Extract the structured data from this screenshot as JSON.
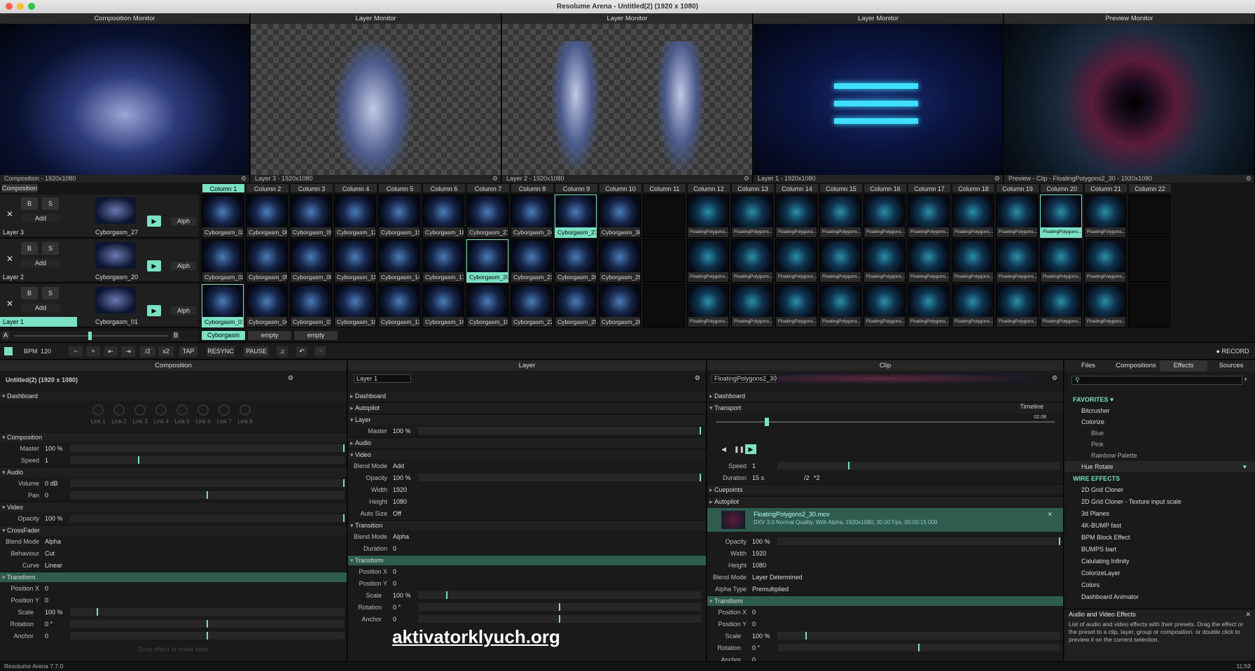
{
  "app": {
    "window_title": "Resolume Arena - Untitled(2) (1920 x 1080)",
    "version": "Resolume Arena 7.7.0",
    "clock": "11:59"
  },
  "monitors": [
    {
      "title": "Composition Monitor",
      "footer": "Composition - 1920x1080"
    },
    {
      "title": "Layer Monitor",
      "footer": "Layer 3 - 1920x1080"
    },
    {
      "title": "Layer Monitor",
      "footer": "Layer 2 - 1920x1080"
    },
    {
      "title": "Layer Monitor",
      "footer": "Layer 1 - 1920x1080"
    },
    {
      "title": "Preview Monitor",
      "footer": "Preview - Clip - FloatingPolygons2_30 - 1920x1080"
    }
  ],
  "deck": {
    "composition_label": "Composition",
    "columns": [
      "Column 1",
      "Column 2",
      "Column 3",
      "Column 4",
      "Column 5",
      "Column 6",
      "Column 7",
      "Column 8",
      "Column 9",
      "Column 10",
      "Column 11",
      "Column 12",
      "Column 13",
      "Column 14",
      "Column 15",
      "Column 16",
      "Column 17",
      "Column 18",
      "Column 19",
      "Column 20",
      "Column 21",
      "Column 22"
    ],
    "layers": [
      {
        "name": "Layer 3",
        "current_clip": "Cyborgasm_27",
        "clips": [
          "Cyborgasm_03",
          "Cyborgasm_06",
          "Cyborgasm_09",
          "Cyborgasm_12",
          "Cyborgasm_15",
          "Cyborgasm_18",
          "Cyborgasm_21",
          "Cyborgasm_24",
          "Cyborgasm_27",
          "Cyborgasm_30",
          "",
          "FloatingPolygons...",
          "FloatingPolygons...",
          "FloatingPolygons...",
          "FloatingPolygons...",
          "FloatingPolygons...",
          "FloatingPolygons...",
          "FloatingPolygons...",
          "FloatingPolygons...",
          "FloatingPolygons...",
          "FloatingPolygons...",
          ""
        ]
      },
      {
        "name": "Layer 2",
        "current_clip": "Cyborgasm_20",
        "clips": [
          "Cyborgasm_02",
          "Cyborgasm_05",
          "Cyborgasm_08",
          "Cyborgasm_11",
          "Cyborgasm_14",
          "Cyborgasm_17",
          "Cyborgasm_20",
          "Cyborgasm_23",
          "Cyborgasm_26",
          "Cyborgasm_29",
          "",
          "FloatingPolygons...",
          "FloatingPolygons...",
          "FloatingPolygons...",
          "FloatingPolygons...",
          "FloatingPolygons...",
          "FloatingPolygons...",
          "FloatingPolygons...",
          "FloatingPolygons...",
          "FloatingPolygons...",
          "FloatingPolygons...",
          ""
        ]
      },
      {
        "name": "Layer 1",
        "current_clip": "Cyborgasm_01",
        "clips": [
          "Cyborgasm_01",
          "Cyborgasm_04",
          "Cyborgasm_07",
          "Cyborgasm_10",
          "Cyborgasm_13",
          "Cyborgasm_16",
          "Cyborgasm_19",
          "Cyborgasm_22",
          "Cyborgasm_25",
          "Cyborgasm_28",
          "",
          "FloatingPolygons...",
          "FloatingPolygons...",
          "FloatingPolygons...",
          "FloatingPolygons...",
          "FloatingPolygons...",
          "FloatingPolygons...",
          "FloatingPolygons...",
          "FloatingPolygons...",
          "FloatingPolygons...",
          "FloatingPolygons...",
          ""
        ]
      }
    ],
    "layer_controls": {
      "bypass": "B",
      "solo": "S",
      "add": "Add",
      "alpha": "Alph",
      "a": "A",
      "b": "B"
    },
    "decks": [
      "Cyborgasm",
      "empty",
      "empty"
    ]
  },
  "toolbar": {
    "bpm_label": "BPM",
    "bpm": "120",
    "minus": "−",
    "plus": "+",
    "half": "/2",
    "double": "x2",
    "tap": "TAP",
    "resync": "RESYNC",
    "pause": "PAUSE",
    "record": "● RECORD"
  },
  "composition_panel": {
    "header": "Composition",
    "name": "Untitled(2) (1920 x 1080)",
    "dashboard": "Dashboard",
    "links": [
      "Link 1",
      "Link 2",
      "Link 3",
      "Link 4",
      "Link 5",
      "Link 6",
      "Link 7",
      "Link 8"
    ],
    "composition": "Composition",
    "master_label": "Master",
    "master": "100 %",
    "speed_label": "Speed",
    "speed": "1",
    "audio": "Audio",
    "volume_label": "Volume",
    "volume": "0 dB",
    "pan_label": "Pan",
    "pan": "0",
    "video": "Video",
    "opacity_label": "Opacity",
    "opacity": "100 %",
    "crossfader": "CrossFader",
    "blend_label": "Blend Mode",
    "blend": "Alpha",
    "behaviour_label": "Behaviour",
    "behaviour": "Cut",
    "curve_label": "Curve",
    "curve": "Linear",
    "transform": "Transform",
    "posx_label": "Position X",
    "posx": "0",
    "posy_label": "Position Y",
    "posy": "0",
    "scale_label": "Scale",
    "scale": "100 %",
    "rotation_label": "Rotation",
    "rotation": "0 °",
    "anchor_label": "Anchor",
    "anchor": "0",
    "drop_hint": "Drop effect or mask here"
  },
  "layer_panel": {
    "header": "Layer",
    "name": "Layer 1",
    "dashboard": "Dashboard",
    "autopilot": "Autopilot",
    "layer": "Layer",
    "master_label": "Master",
    "master": "100 %",
    "audio": "Audio",
    "video": "Video",
    "blend_label": "Blend Mode",
    "blend": "Add",
    "opacity_label": "Opacity",
    "opacity": "100 %",
    "width_label": "Width",
    "width": "1920",
    "height_label": "Height",
    "height": "1080",
    "autosize_label": "Auto Size",
    "autosize": "Off",
    "transition": "Transition",
    "tblend_label": "Blend Mode",
    "tblend": "Alpha",
    "duration_label": "Duration",
    "duration": "0",
    "transform": "Transform",
    "posx_label": "Position X",
    "posx": "0",
    "posy_label": "Position Y",
    "posy": "0",
    "scale_label": "Scale",
    "scale": "100 %",
    "rotation_label": "Rotation",
    "rotation": "0 °",
    "anchor_label": "Anchor",
    "anchor": "0"
  },
  "clip_panel": {
    "header": "Clip",
    "name": "FloatingPolygons2_30",
    "dashboard": "Dashboard",
    "transport": "Transport",
    "timeline": "Timeline",
    "time_end": "02.08",
    "speed_label": "Speed",
    "speed": "1",
    "duration_label": "Duration",
    "duration": "15 s",
    "half": "/2",
    "double": "*2",
    "cuepoints": "Cuepoints",
    "autopilot": "Autopilot",
    "file": "FloatingPolygons2_30.mov",
    "file_info": "DXV 3.0 Normal Quality, With Alpha, 1920x1080, 30.00 Fps, 00:00:15.000",
    "opacity_label": "Opacity",
    "opacity": "100 %",
    "width_label": "Width",
    "width": "1920",
    "height_label": "Height",
    "height": "1080",
    "blend_label": "Blend Mode",
    "blend": "Layer Determined",
    "alpha_label": "Alpha Type",
    "alpha": "Premultiplied",
    "transform": "Transform",
    "posx_label": "Position X",
    "posx": "0",
    "posy_label": "Position Y",
    "posy": "0",
    "scale_label": "Scale",
    "scale": "100 %",
    "rotation_label": "Rotation",
    "rotation": "0 °",
    "anchor_label": "Anchor",
    "anchor": "0"
  },
  "browser": {
    "tabs": [
      "Files",
      "Compositions",
      "Effects",
      "Sources"
    ],
    "favorites": "FAVORITES ♥",
    "fav_items": [
      "Bitcrusher",
      "Colorize",
      "Blue",
      "Pink",
      "Rainbow Palette",
      "Hue Rotate"
    ],
    "wire": "WIRE EFFECTS",
    "wire_items": [
      "2D Grid Cloner",
      "2D Grid Cloner - Texture input scale",
      "3d Planes",
      "4K-BUMP fast",
      "BPM Block Effect",
      "BUMPS bart",
      "Calulating Infinity",
      "ColorizeLayer",
      "Colors",
      "Dashboard Animator"
    ],
    "info_title": "Audio and Video Effects",
    "info_text": "List of audio and video effects with their presets. Drag the effect or the preset to a clip, layer, group or composition. or double click to preview it on the current selection."
  },
  "watermark": "aktivatorklyuch.org",
  "colors": {
    "accent": "#7be0c4",
    "highlight": "#2e5c4f"
  }
}
